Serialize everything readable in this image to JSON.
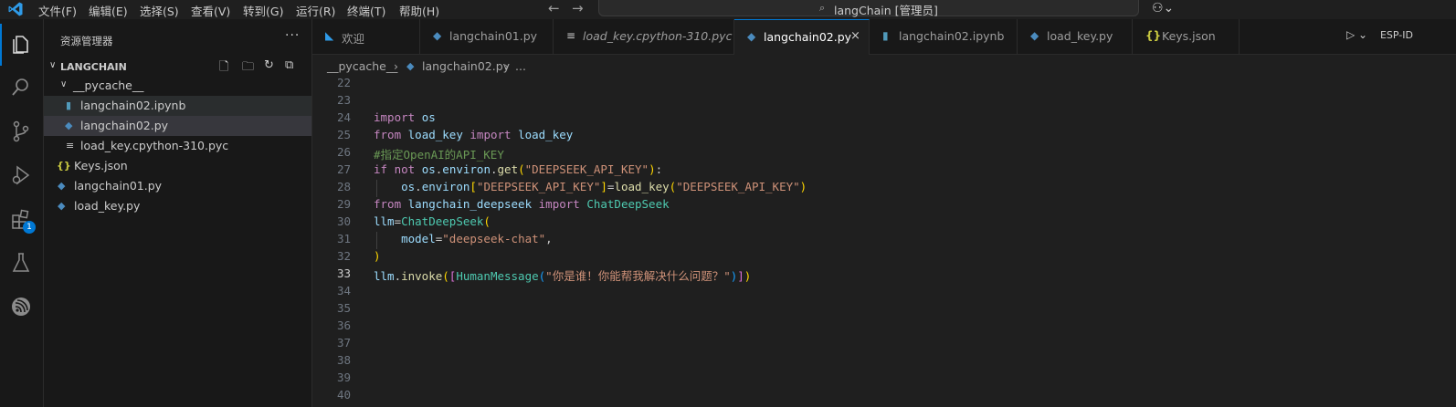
{
  "menu": [
    "文件(F)",
    "编辑(E)",
    "选择(S)",
    "查看(V)",
    "转到(G)",
    "运行(R)",
    "终端(T)",
    "帮助(H)"
  ],
  "command_center": {
    "text": "langChain [管理员]"
  },
  "activity_bar": {
    "extensions_badge": "1"
  },
  "sidebar": {
    "title": "资源管理器",
    "folder": "LANGCHAIN",
    "tree": [
      {
        "label": "__pycache__",
        "type": "folder"
      },
      {
        "label": "langchain02.ipynb",
        "type": "notebook"
      },
      {
        "label": "langchain02.py",
        "type": "python"
      },
      {
        "label": "load_key.cpython-310.pyc",
        "type": "pyc"
      },
      {
        "label": "Keys.json",
        "type": "json"
      },
      {
        "label": "langchain01.py",
        "type": "python"
      },
      {
        "label": "load_key.py",
        "type": "python"
      }
    ]
  },
  "tabs": [
    {
      "label": "欢迎",
      "icon": "vscode-icon"
    },
    {
      "label": "langchain01.py",
      "icon": "python-icon"
    },
    {
      "label": "load_key.cpython-310.pyc",
      "icon": "file-lines-icon"
    },
    {
      "label": "langchain02.py",
      "icon": "python-icon",
      "active": true
    },
    {
      "label": "langchain02.ipynb",
      "icon": "notebook-icon"
    },
    {
      "label": "load_key.py",
      "icon": "python-icon"
    },
    {
      "label": "Keys.json",
      "icon": "json-icon"
    }
  ],
  "tab_actions": {
    "run_label": "ESP-ID"
  },
  "breadcrumb": [
    "__pycache__",
    "langchain02.py",
    "..."
  ],
  "editor": {
    "line_numbers": [
      "22",
      "23",
      "24",
      "25",
      "26",
      "27",
      "28",
      "29",
      "30",
      "31",
      "32",
      "33",
      "34",
      "35",
      "36",
      "37",
      "38",
      "39",
      "40"
    ],
    "current_line": "33",
    "code": [
      "",
      "",
      "import os",
      "from load_key import load_key",
      "#指定OpenAI的API_KEY",
      "if not os.environ.get(\"DEEPSEEK_API_KEY\"):",
      "    os.environ[\"DEEPSEEK_API_KEY\"]=load_key(\"DEEPSEEK_API_KEY\")",
      "from langchain_deepseek import ChatDeepSeek",
      "llm=ChatDeepSeek(",
      "    model=\"deepseek-chat\",",
      ")",
      "llm.invoke([HumanMessage(\"你是谁！你能帮我解决什么问题？\")])",
      "",
      "",
      "",
      "",
      "",
      "",
      ""
    ]
  },
  "colors": {
    "accent": "#0078d4",
    "background": "#1f1f1f",
    "sidebar": "#181818"
  }
}
